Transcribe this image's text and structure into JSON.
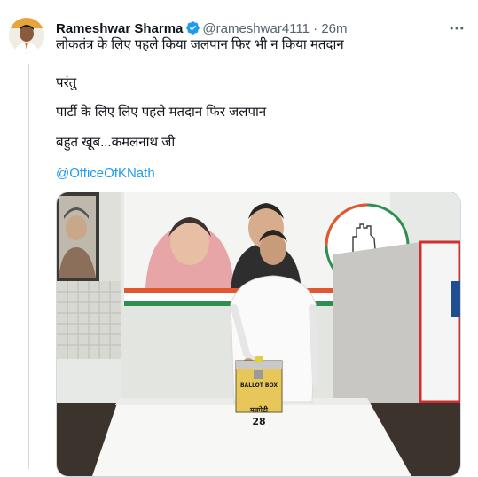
{
  "author": {
    "name": "Rameshwar Sharma",
    "handle": "@rameshwar4111",
    "separator": "·",
    "time": "26m",
    "verified": true
  },
  "tweet_lines": [
    "लोकतंत्र के लिए पहले किया जलपान फिर भी न किया मतदान",
    "परंतु",
    "पार्टी के लिए लिए पहले मतदान फिर जलपान",
    "बहुत खूब...कमलनाथ जी"
  ],
  "mention": "@OfficeOfKNath",
  "ballot_box": {
    "line1": "BALLOT BOX",
    "line2": "मतपेटी",
    "number": "28"
  },
  "icons": {
    "verified": "verified-badge-icon",
    "more": "more-options-icon"
  },
  "colors": {
    "verified": "#1d9bf0",
    "link": "#1d9bf0",
    "secondary_text": "#536471",
    "divider": "#cfd9de"
  }
}
